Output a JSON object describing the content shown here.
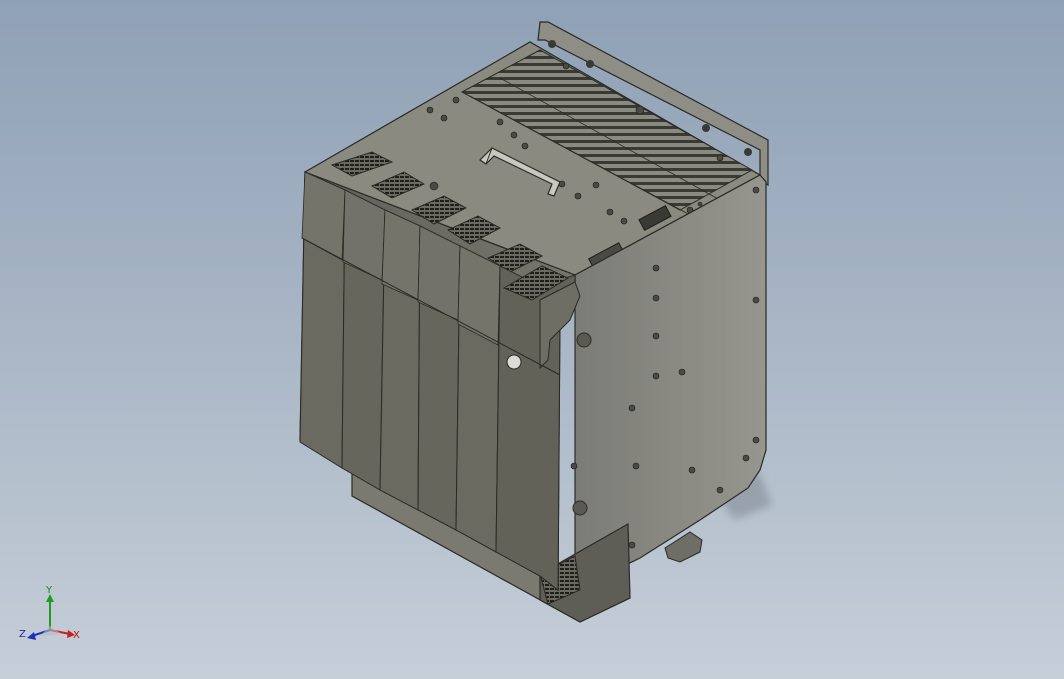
{
  "viewport": {
    "background_top": "#8fa1b6",
    "background_bottom": "#c6ced8"
  },
  "model": {
    "body_color": "#6e6e62",
    "top_color": "#8a8a80",
    "side_color": "#8c8c86",
    "edge_color": "#2a2a26"
  },
  "triad": {
    "x_label": "X",
    "y_label": "Y",
    "z_label": "Z",
    "x_color": "#c81e1e",
    "y_color": "#1e9e1e",
    "z_color": "#1e32b4"
  }
}
